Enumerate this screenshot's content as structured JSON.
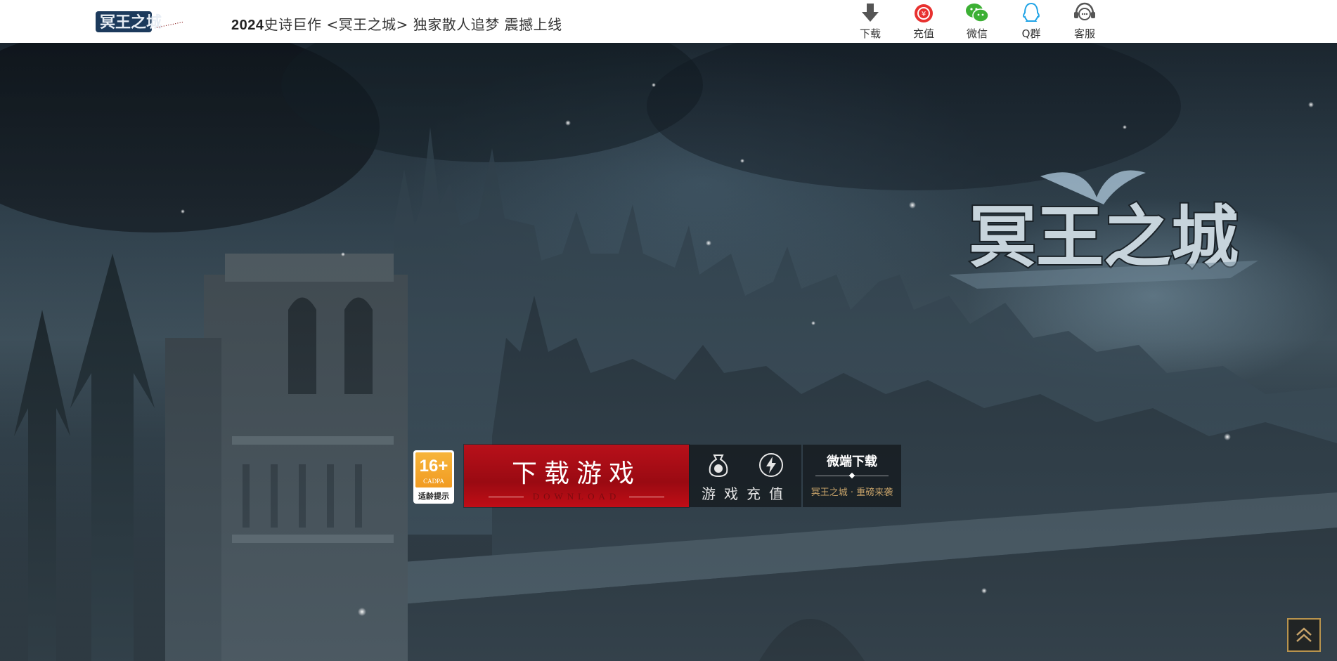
{
  "header": {
    "brand_alt": "冥王之城",
    "brand_tagline": "…………",
    "slogan_year": "2024",
    "slogan_text": "史诗巨作 <冥王之城> 独家散人追梦  震撼上线",
    "nav": [
      {
        "label": "下载",
        "icon": "download-icon"
      },
      {
        "label": "充值",
        "icon": "recharge-icon"
      },
      {
        "label": "微信",
        "icon": "wechat-icon"
      },
      {
        "label": "Q群",
        "icon": "qq-icon"
      },
      {
        "label": "客服",
        "icon": "customer-service-icon"
      }
    ]
  },
  "hero": {
    "game_logo": "冥王之城",
    "age_rating": {
      "age": "16+",
      "org": "CADPA",
      "tip": "适龄提示"
    },
    "download": {
      "title": "下载游戏",
      "subtitle": "DOWNLOAD"
    },
    "recharge": {
      "label": "游戏充值"
    },
    "wechat_download": {
      "title": "微端下载",
      "subtitle": "冥王之城 · 重磅来袭"
    },
    "back_to_top_icon": "chevron-up-icon"
  },
  "colors": {
    "download_red": "#b8101a",
    "gold": "#c9a46a",
    "age_orange": "#f19b22"
  }
}
